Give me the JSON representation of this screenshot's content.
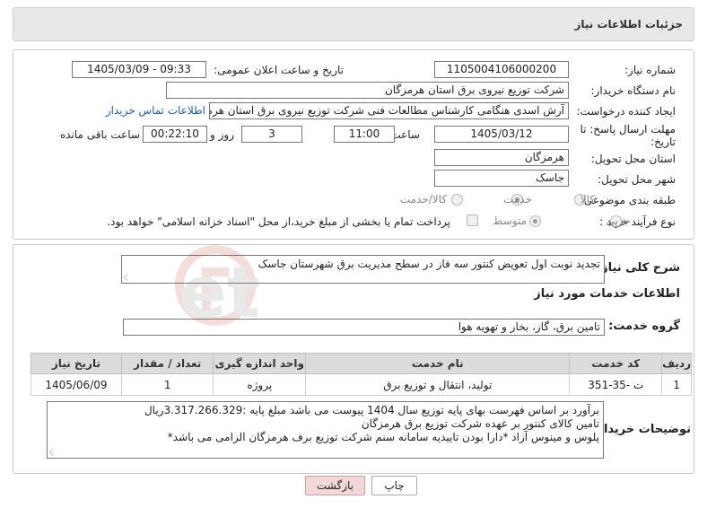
{
  "header": {
    "title": "جزئیات اطلاعات نیاز"
  },
  "fields": {
    "need_number_label": "شماره نیاز:",
    "need_number": "1105004106000200",
    "announce_label": "تاریخ و ساعت اعلان عمومی:",
    "announce_value": "1405/03/09 - 09:33",
    "buyer_org_label": "نام دستگاه خریدار:",
    "buyer_org": "شرکت توزیع نیروی برق استان هرمزگان",
    "requester_label": "ایجاد کننده درخواست:",
    "requester": "آرش اسدی هنگامی کارشناس مطالعات فنی شرکت توزیع نیروی برق استان هرمزگان",
    "contact_link": "اطلاعات تماس خریدار",
    "deadline_label_1": "مهلت ارسال پاسخ: تا",
    "deadline_label_2": "تاریخ:",
    "deadline_date": "1405/03/12",
    "time_label": "ساعت",
    "deadline_time": "11:00",
    "days_value": "3",
    "days_label": "روز و",
    "remaining_time": "00:22:10",
    "remaining_label": "ساعت باقی مانده",
    "province_label": "استان محل تحویل:",
    "province": "هرمزگان",
    "city_label": "شهر محل تحویل:",
    "city": "جاسک",
    "category_label": "طبقه بندی موضوعی:",
    "category_options": [
      "کالا",
      "خدمت",
      "کالا/خدمت"
    ],
    "category_selected": "خدمت",
    "process_label": "نوع فرآیند خرید :",
    "process_options": [
      "جزیی",
      "متوسط"
    ],
    "process_selected": "متوسط",
    "payment_note": "پرداخت تمام یا بخشی از مبلغ خرید،از محل \"اسناد خزانه اسلامی\" خواهد بود."
  },
  "summary": {
    "label": "شرح کلی نیاز:",
    "text": "تجدید نوبت اول تعویض کنتور سه فاز در سطح مدیریت برق شهرستان جاسک"
  },
  "services": {
    "section_title": "اطلاعات خدمات مورد نیاز",
    "group_label": "گروه خدمت:",
    "group_value": "تامین برق، گاز، بخار و تهویه هوا",
    "columns": [
      "ردیف",
      "کد خدمت",
      "نام خدمت",
      "واحد اندازه گیری",
      "تعداد / مقدار",
      "تاریخ نیاز"
    ],
    "rows": [
      {
        "row": "1",
        "code": "ت -35-351",
        "name": "تولید، انتقال و توزیع برق",
        "unit": "پروژه",
        "qty": "1",
        "date": "1405/06/09"
      }
    ]
  },
  "buyer_notes": {
    "label": "توضیحات خریدار:",
    "lines": [
      "برآورد بر اساس فهرست بهای پایه توزیع سال 1404 پیوست می باشد مبلغ پایه :3.317.266.329ریال",
      "تامین کالای کنتور بر عهده شرکت توزیع برق هرمزگان",
      "پلوس و مینوس آزاد *دارا بودن تاییدیه سامانه سنم شرکت توزیع برف هرمزگان الزامی می باشد*"
    ]
  },
  "buttons": {
    "print": "چاپ",
    "back": "بازگشت"
  },
  "watermark": {
    "text": "AriaTender.net"
  },
  "colors": {
    "accent_red": "#c0392b",
    "link_blue": "#1a5fb4",
    "back_button_bg": "#f4d7d7"
  }
}
